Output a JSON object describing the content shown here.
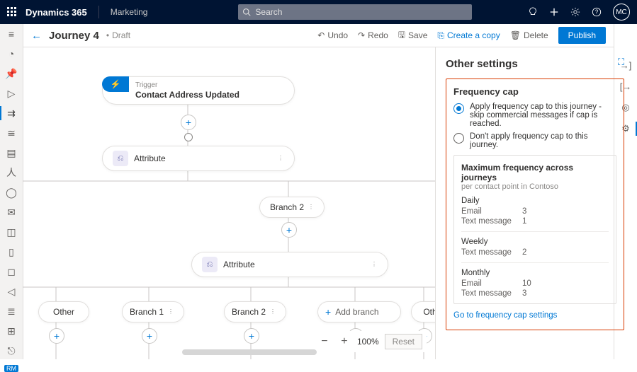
{
  "topbar": {
    "brand": "Dynamics 365",
    "product": "Marketing",
    "searchPlaceholder": "Search",
    "avatar": "MC"
  },
  "header": {
    "title": "Journey 4",
    "status": "Draft",
    "undo": "Undo",
    "redo": "Redo",
    "save": "Save",
    "copy": "Create a copy",
    "delete": "Delete",
    "publish": "Publish"
  },
  "canvas": {
    "triggerLabel": "Trigger",
    "triggerName": "Contact Address Updated",
    "attribute": "Attribute",
    "branch2": "Branch 2",
    "branch1": "Branch 1",
    "addBranch": "Add branch",
    "other": "Other",
    "otherShort": "Oth",
    "zoom": "100%",
    "reset": "Reset"
  },
  "leftrail": {
    "badge": "RM"
  },
  "panel": {
    "title": "Other settings",
    "fcTitle": "Frequency cap",
    "optApply": "Apply frequency cap to this journey - skip commercial messages if cap is reached.",
    "optSkip": "Don't apply frequency cap to this journey.",
    "maxTitle": "Maximum frequency across journeys",
    "maxSub": "per contact point in Contoso",
    "daily": "Daily",
    "weekly": "Weekly",
    "monthly": "Monthly",
    "email": "Email",
    "text": "Text message",
    "v_dailyEmail": "3",
    "v_dailyText": "1",
    "v_weeklyText": "2",
    "v_monthlyEmail": "10",
    "v_monthlyText": "3",
    "goLink": "Go to frequency cap settings"
  }
}
